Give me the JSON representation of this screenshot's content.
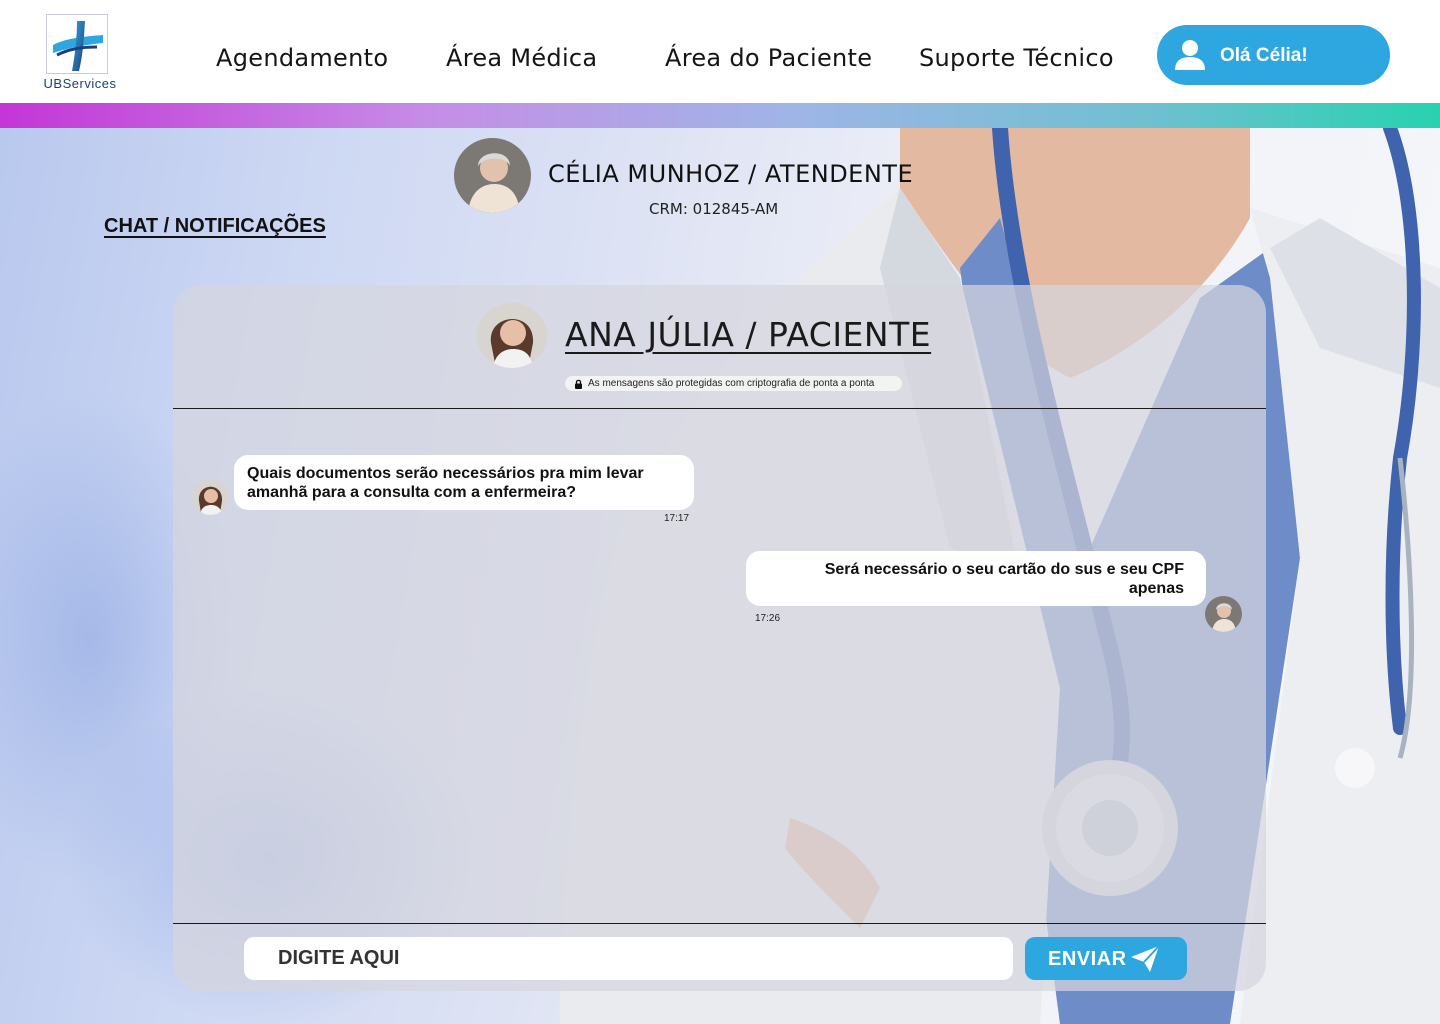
{
  "brand": {
    "logo_text": "UBServices",
    "accent_color": "#2ea7e0",
    "logo_dark": "#1f3f7a"
  },
  "nav": {
    "items": [
      {
        "label": "Agendamento"
      },
      {
        "label": "Área Médica"
      },
      {
        "label": "Área do Paciente"
      },
      {
        "label": "Suporte Técnico"
      }
    ],
    "user_button": {
      "label": "Olá Célia!",
      "icon": "user-icon"
    }
  },
  "attendant": {
    "name": "CÉLIA MUNHOZ / ATENDENTE",
    "crm": "CRM: 012845-AM"
  },
  "section": {
    "title": "CHAT / NOTIFICAÇÕES"
  },
  "chat": {
    "patient_name": "ANA JÚLIA / PACIENTE",
    "encryption_notice": "As mensagens são protegidas com criptografia de ponta a ponta",
    "messages": [
      {
        "direction": "incoming",
        "text": "Quais documentos serão necessários pra mim levar amanhã para a consulta com a enfermeira?",
        "time": "17:17"
      },
      {
        "direction": "outgoing",
        "text": "Será necessário o seu cartão do sus e seu CPF apenas",
        "time": "17:26"
      }
    ],
    "input_placeholder": "DIGITE AQUI",
    "send_label": "ENVIAR"
  }
}
